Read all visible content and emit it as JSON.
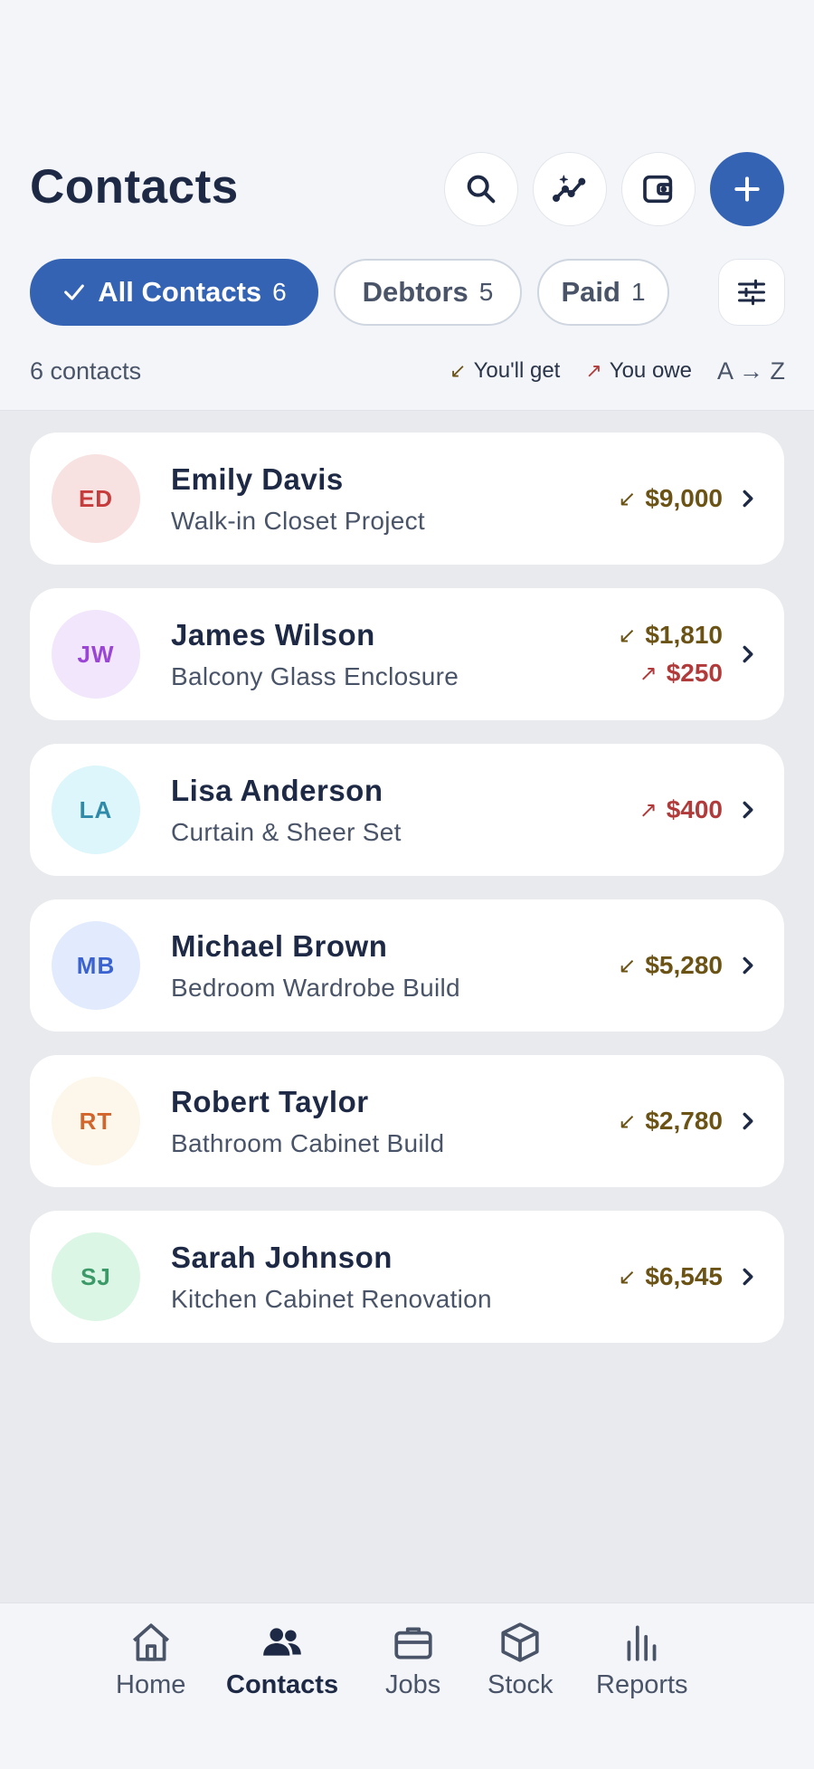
{
  "header": {
    "title": "Contacts"
  },
  "actions": {
    "search": "search-icon",
    "insights": "sparkle-chart-icon",
    "wallet": "wallet-icon",
    "add": "plus-icon"
  },
  "filters": [
    {
      "label": "All Contacts",
      "count": "6",
      "active": true
    },
    {
      "label": "Debtors",
      "count": "5",
      "active": false
    },
    {
      "label": "Paid",
      "count": "1",
      "active": false
    }
  ],
  "summary": {
    "count_text": "6 contacts",
    "get_label": "You'll get",
    "owe_label": "You owe",
    "sort_label": "A → Z"
  },
  "contacts": [
    {
      "initials": "ED",
      "name": "Emily Davis",
      "project": "Walk-in Closet Project",
      "get": "$9,000",
      "owe": null
    },
    {
      "initials": "JW",
      "name": "James Wilson",
      "project": "Balcony Glass Enclosure",
      "get": "$1,810",
      "owe": "$250"
    },
    {
      "initials": "LA",
      "name": "Lisa Anderson",
      "project": "Curtain & Sheer Set",
      "get": null,
      "owe": "$400"
    },
    {
      "initials": "MB",
      "name": "Michael Brown",
      "project": "Bedroom Wardrobe Build",
      "get": "$5,280",
      "owe": null
    },
    {
      "initials": "RT",
      "name": "Robert Taylor",
      "project": "Bathroom Cabinet Build",
      "get": "$2,780",
      "owe": null
    },
    {
      "initials": "SJ",
      "name": "Sarah Johnson",
      "project": "Kitchen Cabinet Renovation",
      "get": "$6,545",
      "owe": null
    }
  ],
  "arrows": {
    "get": "↙",
    "owe": "↗"
  },
  "nav": [
    {
      "label": "Home",
      "icon": "home-icon"
    },
    {
      "label": "Contacts",
      "icon": "people-icon",
      "active": true
    },
    {
      "label": "Jobs",
      "icon": "briefcase-icon"
    },
    {
      "label": "Stock",
      "icon": "box-icon"
    },
    {
      "label": "Reports",
      "icon": "bar-chart-icon"
    }
  ],
  "colors": {
    "accent": "#3563b4",
    "get": "#6b5316",
    "owe": "#b13a3a",
    "avatar_ed": "#f7e1e1",
    "avatar_jw": "#f1e6fb",
    "avatar_la": "#dcf6fb",
    "avatar_mb": "#e2ebfd",
    "avatar_rt": "#fdf6ea",
    "avatar_sj": "#dcf6e6"
  }
}
